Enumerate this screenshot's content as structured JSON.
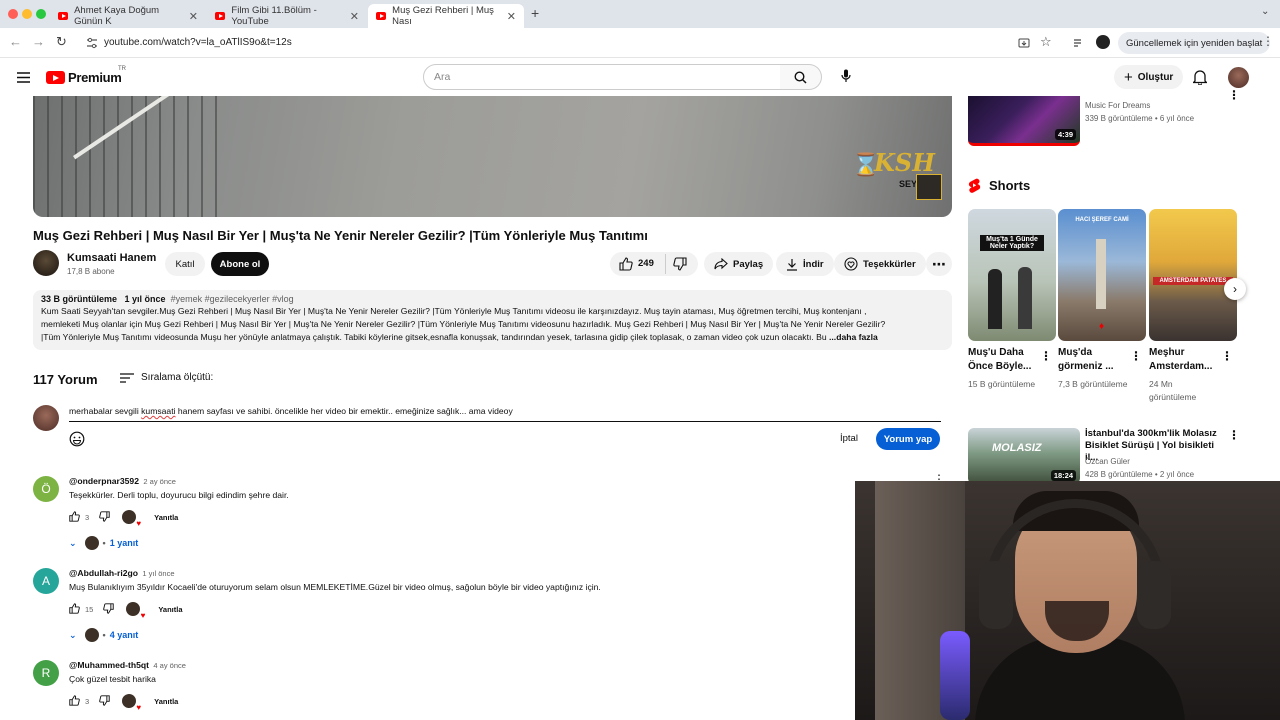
{
  "browser": {
    "tabs": [
      {
        "label": "Ahmet Kaya Doğum Günün K"
      },
      {
        "label": "Film Gibi 11.Bölüm - YouTube"
      },
      {
        "label": "Muş Gezi Rehberi | Muş Nası"
      }
    ],
    "url": "youtube.com/watch?v=la_oATlIS9o&t=12s",
    "update_label": "Güncellemek için yeniden başlat"
  },
  "header": {
    "logo": "Premium",
    "region": "TR",
    "search_placeholder": "Ara",
    "create_label": "Oluştur"
  },
  "video": {
    "title": "Muş Gezi Rehberi | Muş Nasıl Bir Yer | Muş'ta Ne Yenir Nereler Gezilir? |Tüm Yönleriyle Muş Tanıtımı",
    "overlay_logo": "KSH",
    "overlay_sub": "SEY",
    "channel": "Kumsaati Hanem",
    "subscribers": "17,8 B abone",
    "join_label": "Katıl",
    "subscribe_label": "Abone ol",
    "likes": "249",
    "share_label": "Paylaş",
    "download_label": "İndir",
    "thanks_label": "Teşekkürler"
  },
  "description": {
    "views": "33 B görüntüleme",
    "age": "1 yıl önce",
    "tags": "#yemek #gezilecekyerler #vlog",
    "line1": "Kum Saati Seyyah'tan sevgiler.Muş Gezi Rehberi | Muş Nasıl Bir Yer | Muş'ta Ne Yenir Nereler Gezilir? |Tüm Yönleriyle Muş Tanıtımı videosu ile karşınızdayız. Muş tayin ataması, Muş öğretmen tercihi, Muş kontenjanı ,",
    "line2": "memleketi Muş olanlar için Muş Gezi Rehberi | Muş Nasıl Bir Yer | Muş'ta Ne Yenir Nereler Gezilir? |Tüm Yönleriyle Muş Tanıtımı videosunu hazırladık. Muş Gezi Rehberi | Muş Nasıl Bir Yer | Muş'ta Ne Yenir Nereler Gezilir?",
    "line3": "|Tüm Yönleriyle Muş Tanıtımı videosunda Muşu her yönüyle anlatmaya çalıştık. Tabiki köylerine gitsek,esnafla konuşsak, tandırından yesek, tarlasına gidip çilek toplasak, o zaman video çok uzun olacaktı. Bu",
    "more": "...daha fazla"
  },
  "comments": {
    "count": "117 Yorum",
    "sort_label": "Sıralama ölçütü:",
    "draft_before": "merhabalar sevgili ",
    "draft_flagged": "kumsaati",
    "draft_after": " hanem sayfası ve sahibi. öncelikle her video bir emektir.. emeğinize sağlık... ama videoy",
    "cancel_label": "İptal",
    "post_label": "Yorum yap",
    "reply_label": "Yanıtla",
    "items": [
      {
        "initial": "Ö",
        "color": "#7cb342",
        "author": "@onderpnar3592",
        "time": "2 ay önce",
        "text": "Teşekkürler. Derli toplu, doyurucu bilgi edindim şehre dair.",
        "likes": "3",
        "replies": "1 yanıt"
      },
      {
        "initial": "A",
        "color": "#26a69a",
        "author": "@Abdullah-ri2go",
        "time": "1 yıl önce",
        "text": "Muş Bulanıklıyım 35yıldır Kocaeli'de oturuyorum selam olsun MEMLEKETİME.Güzel bir video olmuş, sağolun böyle bir video yaptığınız için.",
        "likes": "15",
        "replies": "4 yanıt"
      },
      {
        "initial": "R",
        "color": "#43a047",
        "author": "@Muhammed-th5qt",
        "time": "4 ay önce",
        "text": "Çok güzel tesbit harika",
        "likes": "3"
      }
    ]
  },
  "sidebar": {
    "video1": {
      "channel": "Music For Dreams",
      "meta": "339 B görüntüleme • 6 yıl önce",
      "duration": "4:39"
    },
    "shorts_heading": "Shorts",
    "shorts": [
      {
        "title": "Muş'u Daha Önce Böyle...",
        "views": "15 B görüntüleme",
        "caption": "Muş'ta 1 Günde Neler Yaptık?"
      },
      {
        "title": "Muş'da görmeniz ...",
        "views": "7,3 B görüntüleme",
        "caption": "HACI ŞEREF CAMİ"
      },
      {
        "title": "Meşhur Amsterdam...",
        "views": "24 Mn görüntüleme",
        "caption": "AMSTERDAM PATATES"
      }
    ],
    "video2": {
      "title": "İstanbul'da 300km'lik Molasız Bisiklet Sürüşü | Yol bisikleti il...",
      "channel": "Özcan Güler",
      "meta": "428 B görüntüleme • 2 yıl önce",
      "duration": "18:24",
      "thumb_caption": "MOLASIZ"
    }
  }
}
